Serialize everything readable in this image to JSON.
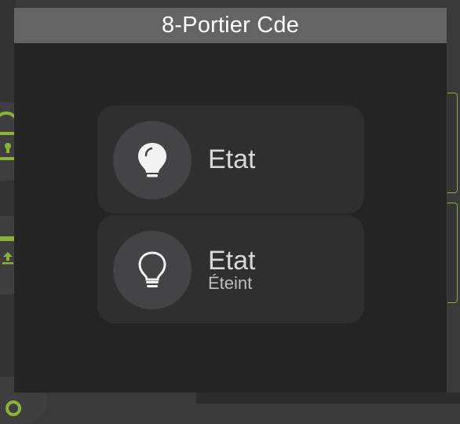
{
  "modal": {
    "title": "8-Portier Cde"
  },
  "cards": [
    {
      "label": "Etat",
      "icon": "lightbulb-filled-icon"
    },
    {
      "label": "Etat",
      "state": "Éteint",
      "icon": "lightbulb-outline-icon"
    }
  ],
  "colors": {
    "accent": "#8bb33a",
    "header_bg": "#646464",
    "modal_bg": "#242424",
    "card_bg": "#2f2f2f"
  }
}
